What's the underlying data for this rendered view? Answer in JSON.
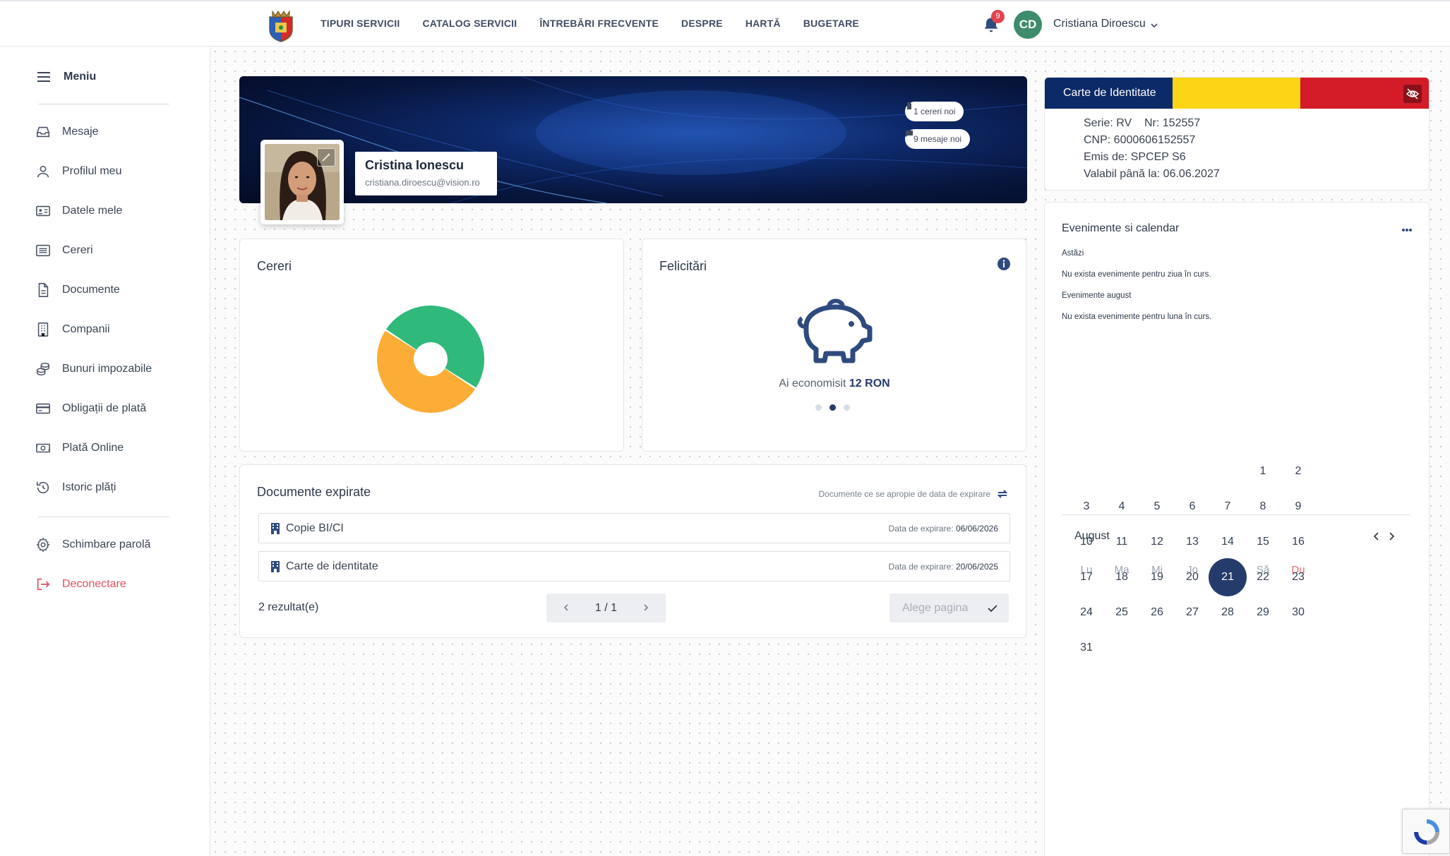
{
  "topnav": {
    "items": [
      "TIPURI SERVICII",
      "CATALOG SERVICII",
      "ÎNTREBĂRI FRECVENTE",
      "DESPRE",
      "HARTĂ",
      "BUGETARE"
    ],
    "notifications_count": "9",
    "avatar_initials": "CD",
    "user_name": "Cristiana Diroescu"
  },
  "sidebar": {
    "menu_label": "Meniu",
    "items": [
      {
        "label": "Mesaje",
        "icon": "inbox-icon"
      },
      {
        "label": "Profilul meu",
        "icon": "user-icon"
      },
      {
        "label": "Datele mele",
        "icon": "id-card-icon"
      },
      {
        "label": "Cereri",
        "icon": "list-icon"
      },
      {
        "label": "Documente",
        "icon": "document-icon"
      },
      {
        "label": "Companii",
        "icon": "building-icon"
      },
      {
        "label": "Bunuri impozabile",
        "icon": "coins-icon"
      },
      {
        "label": "Obligații de plată",
        "icon": "credit-card-icon"
      },
      {
        "label": "Plată Online",
        "icon": "money-icon"
      },
      {
        "label": "Istoric plăți",
        "icon": "history-icon"
      }
    ],
    "bottom_items": [
      {
        "label": "Schimbare parolă",
        "icon": "gear-icon"
      },
      {
        "label": "Deconectare",
        "icon": "logout-icon"
      }
    ]
  },
  "profile": {
    "name": "Cristina Ionescu",
    "email": "cristiana.diroescu@vision.ro",
    "new_requests": "1 cereri noi",
    "new_messages": "9 mesaje noi"
  },
  "id_card": {
    "title": "Carte de Identitate",
    "serie": "Serie: RV",
    "nr": "Nr: 152557",
    "cnp": "CNP: 6000606152557",
    "emis": "Emis de: SPCEP S6",
    "valid": "Valabil până la: 06.06.2027"
  },
  "cereri": {
    "title": "Cereri",
    "chart_data": {
      "type": "pie",
      "donut": true,
      "categories": [
        "",
        ""
      ],
      "values": [
        50,
        50
      ],
      "colors": [
        "#2fb97a",
        "#fbad35"
      ]
    }
  },
  "felicitari": {
    "title": "Felicitări",
    "saved_prefix": "Ai economisit",
    "saved_value": "12 RON",
    "carousel_active": 2,
    "carousel_total": 3
  },
  "documents": {
    "title": "Documente expirate",
    "subtitle": "Documente ce se apropie de data de expirare",
    "expiry_label": "Data de expirare:",
    "rows": [
      {
        "name": "Copie BI/CI",
        "date": "06/06/2026"
      },
      {
        "name": "Carte de identitate",
        "date": "20/06/2025"
      }
    ],
    "results": "2 rezultat(e)",
    "page": "1 / 1",
    "page_select_placeholder": "Alege pagina"
  },
  "events": {
    "title": "Evenimente si calendar",
    "today_label": "Astăzi",
    "today_empty": "Nu exista evenimente pentru ziua în curs.",
    "month_label": "Evenimente august",
    "month_empty": "Nu exista evenimente pentru luna în curs."
  },
  "calendar": {
    "month": "August",
    "weekdays": [
      "Lu",
      "Ma",
      "Mi",
      "Jo",
      "Vi",
      "Să",
      "Du"
    ],
    "first_weekday_index": 5,
    "days_in_month": 31,
    "selected_day": 21,
    "weekend_color": "#e26a72"
  }
}
